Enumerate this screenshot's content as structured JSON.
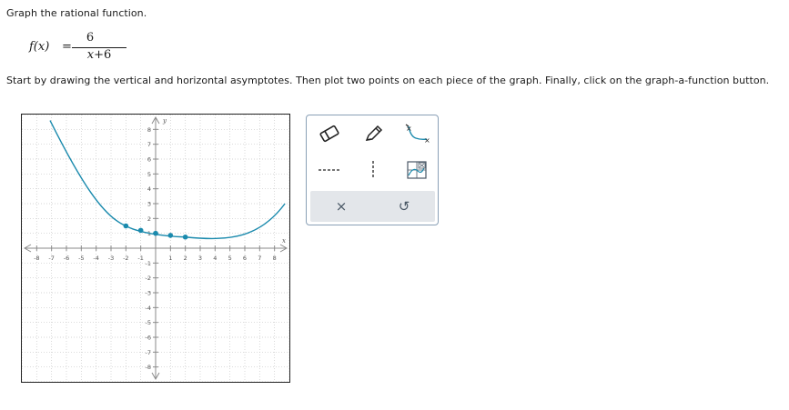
{
  "question": {
    "prompt": "Graph the rational function.",
    "function_name": "f(x)",
    "equals": "=",
    "numerator": "6",
    "denominator_var": "x",
    "denominator_rest": "+6",
    "instructions": "Start by drawing the vertical and horizontal asymptotes. Then plot two points on each piece of the graph. Finally, click on the graph-a-function button."
  },
  "graph": {
    "x_axis_label": "x",
    "y_axis_label": "y",
    "x_range": [
      -9,
      9
    ],
    "y_range": [
      -9,
      9
    ],
    "x_ticks": [
      -8,
      -7,
      -6,
      -5,
      -4,
      -3,
      -2,
      -1,
      1,
      2,
      3,
      4,
      5,
      6,
      7,
      8
    ],
    "y_ticks": [
      8,
      7,
      6,
      5,
      4,
      3,
      2,
      1,
      -1,
      -2,
      -3,
      -4,
      -5,
      -6,
      -7,
      -8
    ],
    "curve_color": "#1a8aad",
    "point_color": "#1a8aad",
    "grid_color": "#c8c8c8",
    "plotted_points": [
      {
        "x": -2,
        "y": 1.5
      },
      {
        "x": -1,
        "y": 1.2
      },
      {
        "x": 0,
        "y": 1
      },
      {
        "x": 1,
        "y": 0.86
      },
      {
        "x": 2,
        "y": 0.75
      }
    ]
  },
  "toolbox": {
    "tools": [
      {
        "name": "eraser-tool",
        "icon": "eraser-icon"
      },
      {
        "name": "pencil-tool",
        "icon": "pencil-icon"
      },
      {
        "name": "rational-curve-tool",
        "icon": "rational-curve-icon"
      },
      {
        "name": "horizontal-asymptote-tool",
        "icon": "horizontal-dashed-line-icon"
      },
      {
        "name": "vertical-asymptote-tool",
        "icon": "vertical-dashed-line-icon"
      },
      {
        "name": "graph-a-function-tool",
        "icon": "graph-a-function-icon"
      }
    ],
    "clear_symbol": "×",
    "undo_symbol": "↺",
    "accent_color": "#4a5866"
  }
}
